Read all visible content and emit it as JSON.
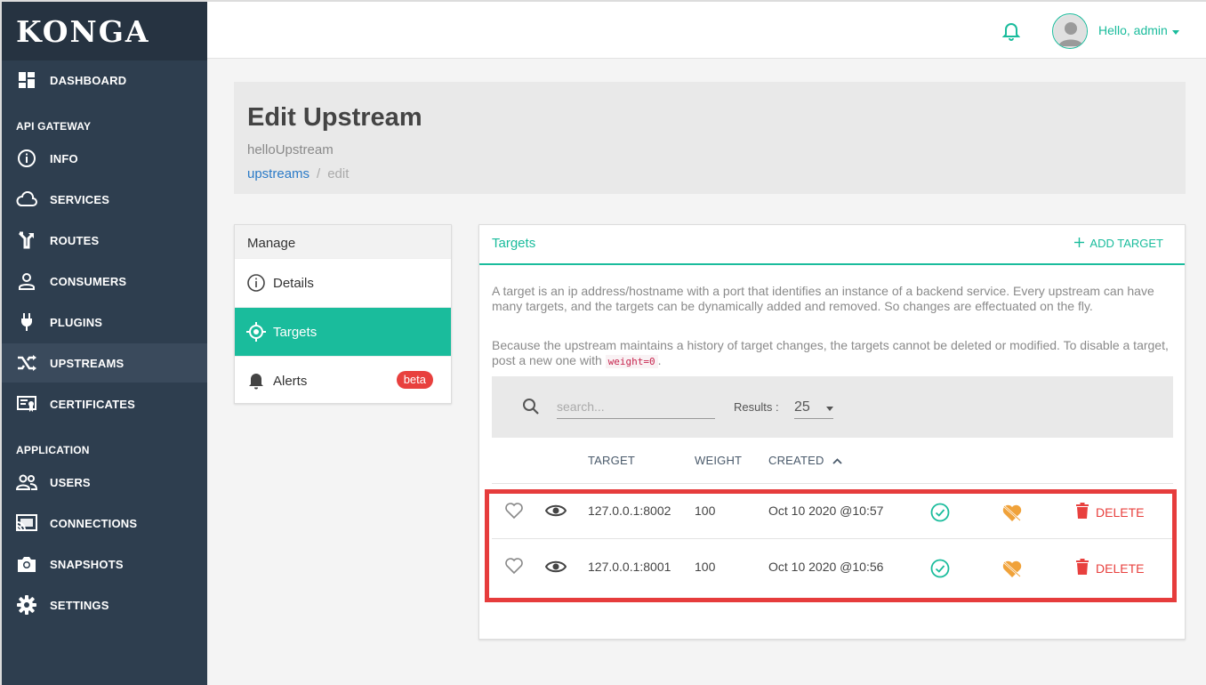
{
  "app": {
    "logo": "KONGA"
  },
  "sidebar": {
    "items": [
      {
        "label": "DASHBOARD",
        "icon": "dashboard-icon"
      },
      {
        "label": "INFO",
        "icon": "info-icon"
      },
      {
        "label": "SERVICES",
        "icon": "cloud-icon"
      },
      {
        "label": "ROUTES",
        "icon": "routes-icon"
      },
      {
        "label": "CONSUMERS",
        "icon": "person-icon"
      },
      {
        "label": "PLUGINS",
        "icon": "plug-icon"
      },
      {
        "label": "UPSTREAMS",
        "icon": "shuffle-icon"
      },
      {
        "label": "CERTIFICATES",
        "icon": "certificate-icon"
      },
      {
        "label": "USERS",
        "icon": "users-icon"
      },
      {
        "label": "CONNECTIONS",
        "icon": "cast-icon"
      },
      {
        "label": "SNAPSHOTS",
        "icon": "camera-icon"
      },
      {
        "label": "SETTINGS",
        "icon": "gear-icon"
      }
    ],
    "sections": {
      "api_gateway": "API GATEWAY",
      "application": "APPLICATION"
    },
    "active": "UPSTREAMS"
  },
  "topbar": {
    "greeting": "Hello, admin"
  },
  "header": {
    "title": "Edit Upstream",
    "subtitle": "helloUpstream",
    "breadcrumb_link": "upstreams",
    "breadcrumb_sep": "/",
    "breadcrumb_current": "edit"
  },
  "manage": {
    "title": "Manage",
    "items": [
      {
        "label": "Details",
        "icon": "info-icon"
      },
      {
        "label": "Targets",
        "icon": "crosshair-icon"
      },
      {
        "label": "Alerts",
        "icon": "bell-icon",
        "badge": "beta"
      }
    ],
    "active": "Targets"
  },
  "targets": {
    "title": "Targets",
    "add_label": "ADD TARGET",
    "desc1": "A target is an ip address/hostname with a port that identifies an instance of a backend service. Every upstream can have many targets, and the targets can be dynamically added and removed. So changes are effectuated on the fly.",
    "desc2_pre": "Because the upstream maintains a history of target changes, the targets cannot be deleted or modified. To disable a target, post a new one with",
    "desc2_code": "weight=0",
    "desc2_post": ".",
    "search_placeholder": "search...",
    "results_label": "Results :",
    "results_value": "25",
    "columns": {
      "target": "TARGET",
      "weight": "WEIGHT",
      "created": "CREATED"
    },
    "rows": [
      {
        "target": "127.0.0.1:8002",
        "weight": "100",
        "created": "Oct 10 2020 @10:57",
        "delete": "DELETE"
      },
      {
        "target": "127.0.0.1:8001",
        "weight": "100",
        "created": "Oct 10 2020 @10:56",
        "delete": "DELETE"
      }
    ]
  },
  "colors": {
    "accent": "#1abc9c",
    "sidebar": "#2e3e4f",
    "danger": "#e8403e",
    "warning": "#f0a23a",
    "highlight": "#e63c3c"
  }
}
